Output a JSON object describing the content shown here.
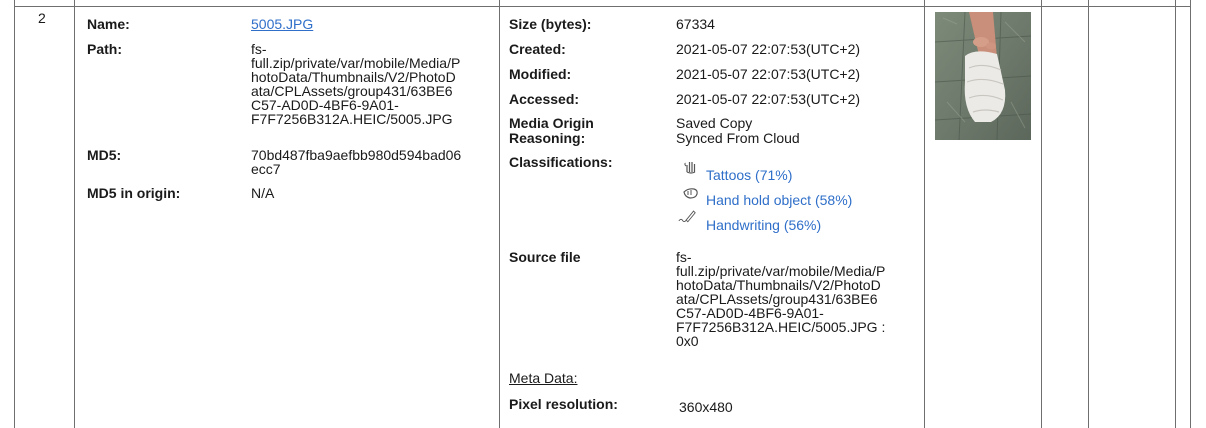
{
  "row_index": "2",
  "left": {
    "name_label": "Name:",
    "name_value": "5005.JPG",
    "path_label": "Path:",
    "path_lines": [
      "fs-",
      "full.zip/private/var/mobile/Media/P",
      "hotoData/Thumbnails/V2/PhotoD",
      "ata/CPLAssets/group431/63BE6",
      "C57-AD0D-4BF6-9A01-",
      "F7F7256B312A.HEIC/5005.JPG"
    ],
    "md5_label": "MD5:",
    "md5_lines": [
      "70bd487fba9aefbb980d594bad06",
      "ecc7"
    ],
    "md5_origin_label": "MD5 in origin:",
    "md5_origin_value": "N/A"
  },
  "right": {
    "size_label": "Size (bytes):",
    "size_value": "67334",
    "created_label": "Created:",
    "created_value": "2021-05-07 22:07:53(UTC+2)",
    "modified_label": "Modified:",
    "modified_value": "2021-05-07 22:07:53(UTC+2)",
    "accessed_label": "Accessed:",
    "accessed_value": "2021-05-07 22:07:53(UTC+2)",
    "origin_label_lines": [
      "Media Origin",
      "Reasoning:"
    ],
    "origin_value_lines": [
      "Saved Copy",
      "Synced From Cloud"
    ],
    "classifications_label": "Classifications:",
    "classifications": [
      {
        "icon": "tattoo-hand-icon",
        "text": "Tattoos (71%)"
      },
      {
        "icon": "hand-hold-icon",
        "text": "Hand hold object (58%)"
      },
      {
        "icon": "pen-handwriting-icon",
        "text": "Handwriting (56%)"
      }
    ],
    "source_label": "Source file",
    "source_lines": [
      "fs-",
      "full.zip/private/var/mobile/Media/P",
      "hotoData/Thumbnails/V2/PhotoD",
      "ata/CPLAssets/group431/63BE6",
      "C57-AD0D-4BF6-9A01-",
      "F7F7256B312A.HEIC/5005.JPG :",
      "0x0"
    ],
    "meta_label": "Meta Data:",
    "resolution_label": "Pixel resolution:",
    "resolution_value": "360x480"
  },
  "colors": {
    "link": "#2f6fc9",
    "border": "#6f6f6f",
    "text": "#1a1a1a"
  },
  "thumbnail": {
    "subject": "photo of a bandaged foot on a tiled floor"
  }
}
